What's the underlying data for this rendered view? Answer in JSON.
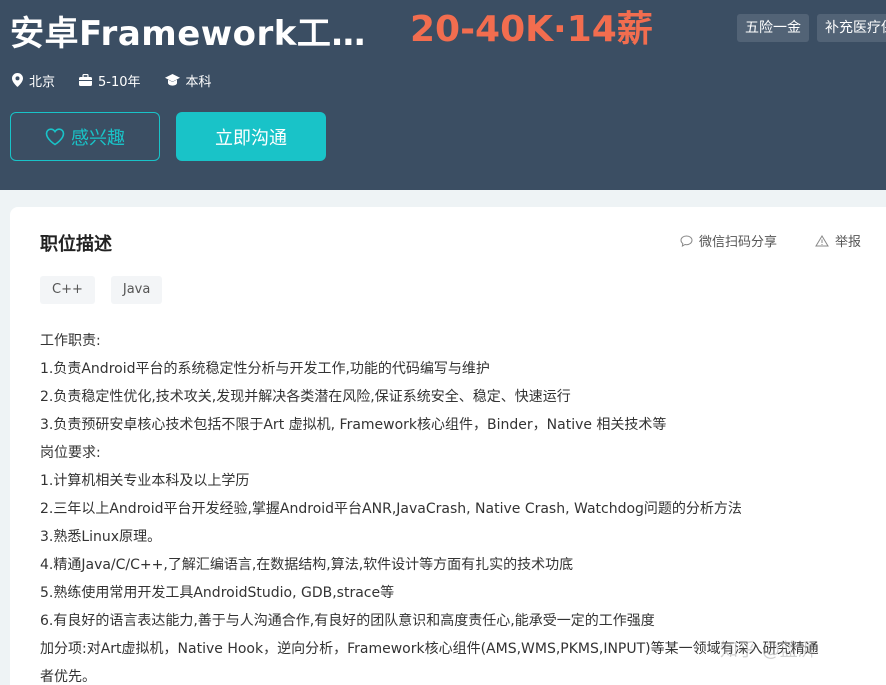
{
  "header": {
    "job_title": "安卓Framework工…",
    "salary": "20-40K·14薪",
    "benefits": [
      "五险一金",
      "补充医疗保险"
    ],
    "location": "北京",
    "experience": "5-10年",
    "education": "本科",
    "interest_button": "感兴趣",
    "chat_button": "立即沟通"
  },
  "detail": {
    "section_title": "职位描述",
    "share_label": "微信扫码分享",
    "report_label": "举报",
    "tags": [
      "C++",
      "Java"
    ],
    "description_lines": [
      "工作职责:",
      "1.负责Android平台的系统稳定性分析与开发工作,功能的代码编写与维护",
      "2.负责稳定性优化,技术攻关,发现并解决各类潜在风险,保证系统安全、稳定、快速运行",
      "3.负责预研安卓核心技术包括不限于Art 虚拟机, Framework核心组件，Binder，Native 相关技术等",
      "岗位要求:",
      "1.计算机相关专业本科及以上学历",
      "2.三年以上Android平台开发经验,掌握Android平台ANR,JavaCrash, Native Crash, Watchdog问题的分析方法",
      "3.熟悉Linux原理。",
      "4.精通Java/C/C++,了解汇编语言,在数据结构,算法,软件设计等方面有扎实的技术功底",
      "5.熟练使用常用开发工具AndroidStudio, GDB,strace等",
      "6.有良好的语言表达能力,善于与人沟通合作,有良好的团队意识和高度责任心,能承受一定的工作强度",
      "加分项:对Art虚拟机，Native Hook，逆向分析，Framework核心组件(AMS,WMS,PKMS,INPUT)等某一领域有深入研究精通",
      "者优先。"
    ]
  },
  "watermark": "知乎 @蓝湃",
  "colors": {
    "header_bg": "#3b4e63",
    "accent": "#19c3c8",
    "salary": "#f26d4f"
  }
}
